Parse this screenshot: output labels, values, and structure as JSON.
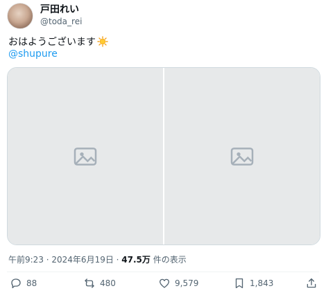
{
  "author": {
    "display_name": "戸田れい",
    "handle": "@toda_rei"
  },
  "tweet": {
    "text": "おはようございます",
    "mention": "@shupure"
  },
  "meta": {
    "time": "午前9:23 · 2024年6月19日 · ",
    "views": "47.5万",
    "views_suffix": " 件の表示"
  },
  "actions": {
    "replies": "88",
    "retweets": "480",
    "likes": "9,579",
    "bookmarks": "1,843"
  },
  "icons": {
    "reply": "reply-icon",
    "retweet": "retweet-icon",
    "like": "heart-icon",
    "bookmark": "bookmark-icon",
    "share": "share-icon"
  },
  "colors": {
    "link": "#1d9bf0",
    "text": "#0f1419",
    "muted": "#536471"
  }
}
